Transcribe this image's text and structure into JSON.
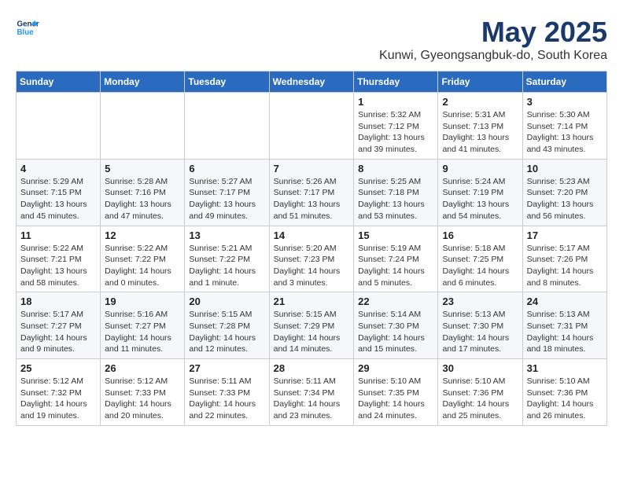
{
  "logo": {
    "line1": "General",
    "line2": "Blue"
  },
  "title": "May 2025",
  "subtitle": "Kunwi, Gyeongsangbuk-do, South Korea",
  "days_of_week": [
    "Sunday",
    "Monday",
    "Tuesday",
    "Wednesday",
    "Thursday",
    "Friday",
    "Saturday"
  ],
  "weeks": [
    [
      {
        "day": "",
        "content": ""
      },
      {
        "day": "",
        "content": ""
      },
      {
        "day": "",
        "content": ""
      },
      {
        "day": "",
        "content": ""
      },
      {
        "day": "1",
        "content": "Sunrise: 5:32 AM\nSunset: 7:12 PM\nDaylight: 13 hours\nand 39 minutes."
      },
      {
        "day": "2",
        "content": "Sunrise: 5:31 AM\nSunset: 7:13 PM\nDaylight: 13 hours\nand 41 minutes."
      },
      {
        "day": "3",
        "content": "Sunrise: 5:30 AM\nSunset: 7:14 PM\nDaylight: 13 hours\nand 43 minutes."
      }
    ],
    [
      {
        "day": "4",
        "content": "Sunrise: 5:29 AM\nSunset: 7:15 PM\nDaylight: 13 hours\nand 45 minutes."
      },
      {
        "day": "5",
        "content": "Sunrise: 5:28 AM\nSunset: 7:16 PM\nDaylight: 13 hours\nand 47 minutes."
      },
      {
        "day": "6",
        "content": "Sunrise: 5:27 AM\nSunset: 7:17 PM\nDaylight: 13 hours\nand 49 minutes."
      },
      {
        "day": "7",
        "content": "Sunrise: 5:26 AM\nSunset: 7:17 PM\nDaylight: 13 hours\nand 51 minutes."
      },
      {
        "day": "8",
        "content": "Sunrise: 5:25 AM\nSunset: 7:18 PM\nDaylight: 13 hours\nand 53 minutes."
      },
      {
        "day": "9",
        "content": "Sunrise: 5:24 AM\nSunset: 7:19 PM\nDaylight: 13 hours\nand 54 minutes."
      },
      {
        "day": "10",
        "content": "Sunrise: 5:23 AM\nSunset: 7:20 PM\nDaylight: 13 hours\nand 56 minutes."
      }
    ],
    [
      {
        "day": "11",
        "content": "Sunrise: 5:22 AM\nSunset: 7:21 PM\nDaylight: 13 hours\nand 58 minutes."
      },
      {
        "day": "12",
        "content": "Sunrise: 5:22 AM\nSunset: 7:22 PM\nDaylight: 14 hours\nand 0 minutes."
      },
      {
        "day": "13",
        "content": "Sunrise: 5:21 AM\nSunset: 7:22 PM\nDaylight: 14 hours\nand 1 minute."
      },
      {
        "day": "14",
        "content": "Sunrise: 5:20 AM\nSunset: 7:23 PM\nDaylight: 14 hours\nand 3 minutes."
      },
      {
        "day": "15",
        "content": "Sunrise: 5:19 AM\nSunset: 7:24 PM\nDaylight: 14 hours\nand 5 minutes."
      },
      {
        "day": "16",
        "content": "Sunrise: 5:18 AM\nSunset: 7:25 PM\nDaylight: 14 hours\nand 6 minutes."
      },
      {
        "day": "17",
        "content": "Sunrise: 5:17 AM\nSunset: 7:26 PM\nDaylight: 14 hours\nand 8 minutes."
      }
    ],
    [
      {
        "day": "18",
        "content": "Sunrise: 5:17 AM\nSunset: 7:27 PM\nDaylight: 14 hours\nand 9 minutes."
      },
      {
        "day": "19",
        "content": "Sunrise: 5:16 AM\nSunset: 7:27 PM\nDaylight: 14 hours\nand 11 minutes."
      },
      {
        "day": "20",
        "content": "Sunrise: 5:15 AM\nSunset: 7:28 PM\nDaylight: 14 hours\nand 12 minutes."
      },
      {
        "day": "21",
        "content": "Sunrise: 5:15 AM\nSunset: 7:29 PM\nDaylight: 14 hours\nand 14 minutes."
      },
      {
        "day": "22",
        "content": "Sunrise: 5:14 AM\nSunset: 7:30 PM\nDaylight: 14 hours\nand 15 minutes."
      },
      {
        "day": "23",
        "content": "Sunrise: 5:13 AM\nSunset: 7:30 PM\nDaylight: 14 hours\nand 17 minutes."
      },
      {
        "day": "24",
        "content": "Sunrise: 5:13 AM\nSunset: 7:31 PM\nDaylight: 14 hours\nand 18 minutes."
      }
    ],
    [
      {
        "day": "25",
        "content": "Sunrise: 5:12 AM\nSunset: 7:32 PM\nDaylight: 14 hours\nand 19 minutes."
      },
      {
        "day": "26",
        "content": "Sunrise: 5:12 AM\nSunset: 7:33 PM\nDaylight: 14 hours\nand 20 minutes."
      },
      {
        "day": "27",
        "content": "Sunrise: 5:11 AM\nSunset: 7:33 PM\nDaylight: 14 hours\nand 22 minutes."
      },
      {
        "day": "28",
        "content": "Sunrise: 5:11 AM\nSunset: 7:34 PM\nDaylight: 14 hours\nand 23 minutes."
      },
      {
        "day": "29",
        "content": "Sunrise: 5:10 AM\nSunset: 7:35 PM\nDaylight: 14 hours\nand 24 minutes."
      },
      {
        "day": "30",
        "content": "Sunrise: 5:10 AM\nSunset: 7:36 PM\nDaylight: 14 hours\nand 25 minutes."
      },
      {
        "day": "31",
        "content": "Sunrise: 5:10 AM\nSunset: 7:36 PM\nDaylight: 14 hours\nand 26 minutes."
      }
    ]
  ]
}
